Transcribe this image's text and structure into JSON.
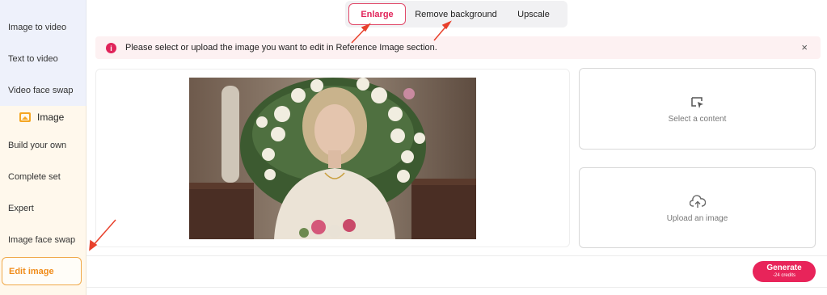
{
  "sidebar": {
    "video_items": [
      {
        "label": "Image to video"
      },
      {
        "label": "Text to video"
      },
      {
        "label": "Video face swap"
      }
    ],
    "image_section": {
      "label": "Image",
      "icon": "image-icon"
    },
    "image_items": [
      {
        "label": "Build your own"
      },
      {
        "label": "Complete set"
      },
      {
        "label": "Expert"
      },
      {
        "label": "Image face swap"
      }
    ],
    "active_item": {
      "label": "Edit image"
    }
  },
  "tabs": [
    {
      "label": "Enlarge",
      "active": true
    },
    {
      "label": "Remove background",
      "active": false
    },
    {
      "label": "Upscale",
      "active": false
    }
  ],
  "notice": {
    "icon": "info-icon",
    "icon_glyph": "i",
    "text": "Please select or upload the image you want to edit in Reference Image section.",
    "close_glyph": "×"
  },
  "reference": {
    "select_label": "Select a content",
    "select_icon": "cursor-select-icon",
    "upload_label": "Upload an image",
    "upload_icon": "cloud-upload-icon"
  },
  "footer": {
    "generate_label": "Generate",
    "credits_label": "-24 credits"
  },
  "colors": {
    "accent": "#e8245a",
    "active_sidebar": "#f08c1a",
    "annotation_arrow": "#e8412c"
  }
}
